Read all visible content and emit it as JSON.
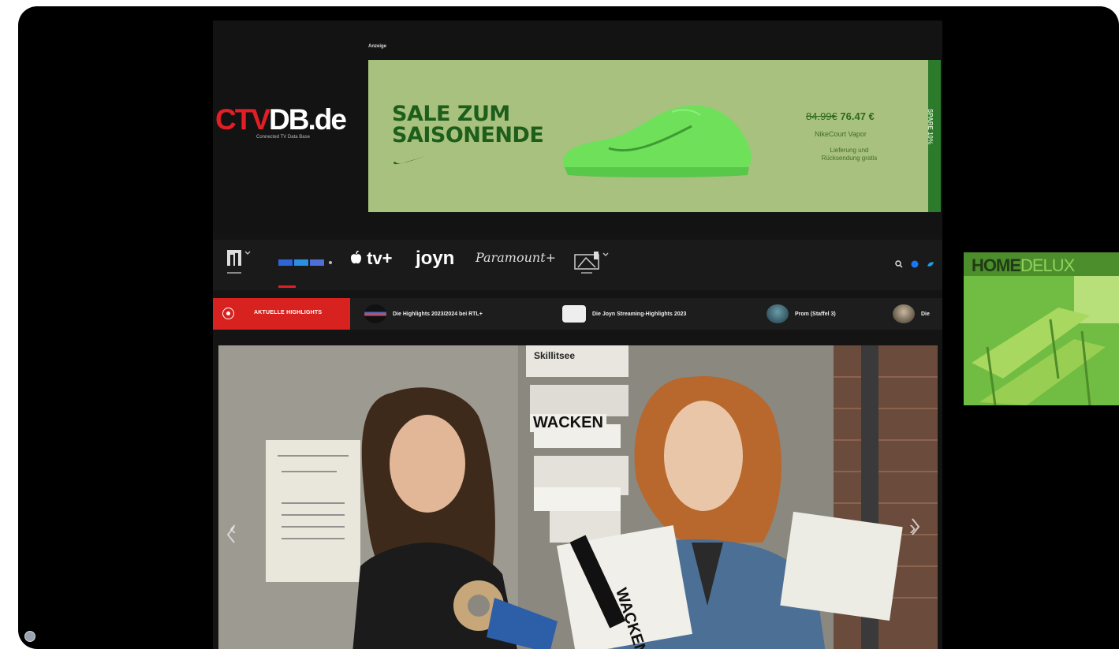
{
  "site": {
    "logo_red": "CTV",
    "logo_white": "DB.de",
    "logo_tagline": "Connected TV Data Base",
    "ad_label": "Anzeige"
  },
  "banner_ad": {
    "headline": "SALE ZUM\nSAISONENDE",
    "price_old": "84.99€",
    "price_new": "76.47 €",
    "product": "NikeCourt Vapor",
    "delivery": "Lieferung und\nRücksendung gratis",
    "side_strip": "SPARE 10%",
    "accent_color": "#a9c17f",
    "text_color": "#1d5e1b"
  },
  "brand_nav": {
    "items": [
      {
        "name": "Mediathek",
        "icon": "mediathek-icon"
      },
      {
        "name": "RTL",
        "icon": "rtl-logo-icon"
      },
      {
        "name": "tv+",
        "icon": "apple-tv-logo-icon"
      },
      {
        "name": "joyn",
        "icon": "joyn-logo-icon"
      },
      {
        "name": "Paramount+",
        "icon": "paramount-logo-icon"
      },
      {
        "name": "Satellit",
        "icon": "satellite-icon"
      }
    ],
    "appletv_label": "tv+",
    "joyn_label": "joyn",
    "paramount_label": "Paramount+",
    "active_color": "#e31e24"
  },
  "ticker": {
    "label": "AKTUELLE HIGHLIGHTS",
    "items": [
      {
        "title": "Die Highlights 2023/2024 bei RTL+"
      },
      {
        "title": "Die Joyn Streaming-Highlights 2023"
      },
      {
        "title": "Prom (Staffel 3)"
      },
      {
        "title": "Die"
      }
    ]
  },
  "hero": {
    "poster_texts": [
      "WACKEN",
      "Skillitsee",
      "WACKEN"
    ],
    "nav_prev": "‹",
    "nav_next": "›"
  },
  "side_ad": {
    "brand_dark": "HOME",
    "brand_light": "DELUX"
  }
}
